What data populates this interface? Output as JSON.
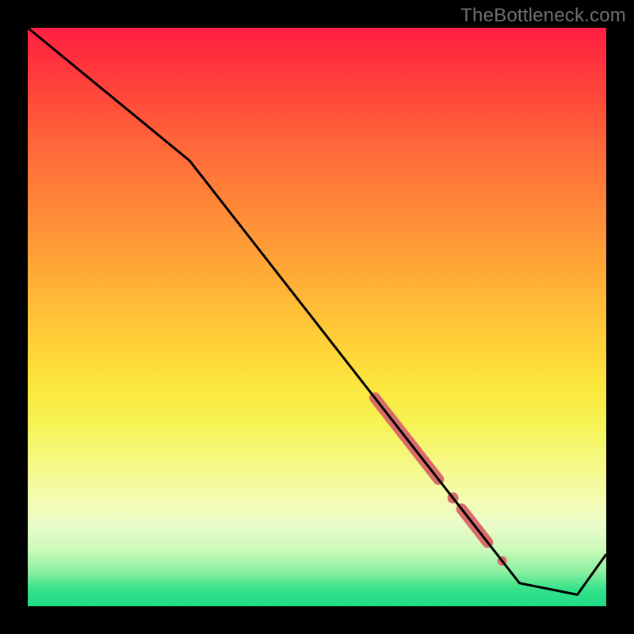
{
  "watermark": "TheBottleneck.com",
  "chart_data": {
    "type": "line",
    "title": "",
    "xlabel": "",
    "ylabel": "",
    "xlim": [
      0,
      100
    ],
    "ylim": [
      0,
      100
    ],
    "series": [
      {
        "name": "curve",
        "color": "#000000",
        "x": [
          0,
          28,
          85,
          95,
          100
        ],
        "y": [
          100,
          77,
          4,
          2,
          9
        ]
      }
    ],
    "highlights": [
      {
        "shape": "capsule",
        "color": "#d96b6b",
        "x_start": 60,
        "x_end": 71,
        "width": 14
      },
      {
        "shape": "dot",
        "color": "#d96b6b",
        "x": 73.5,
        "r": 7
      },
      {
        "shape": "capsule",
        "color": "#d96b6b",
        "x_start": 75,
        "x_end": 79.5,
        "width": 14
      },
      {
        "shape": "dot",
        "color": "#d96b6b",
        "x": 82,
        "r": 6
      }
    ]
  }
}
